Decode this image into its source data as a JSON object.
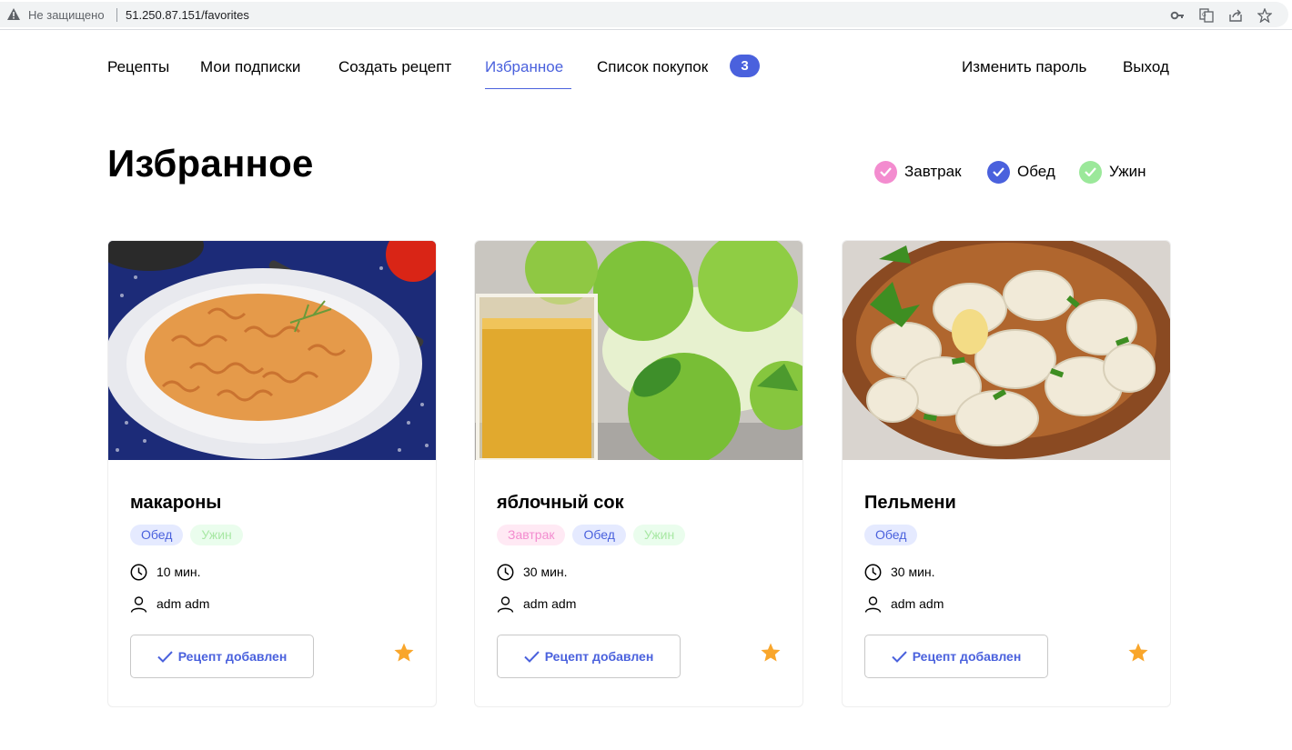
{
  "browser": {
    "security_text": "Не защищено",
    "url": "51.250.87.151/favorites",
    "icons": [
      "warning-icon",
      "key-icon",
      "translate-icon",
      "share-icon",
      "bookmark-star-icon"
    ]
  },
  "nav": {
    "recipes": "Рецепты",
    "subscriptions": "Мои подписки",
    "create_recipe": "Создать рецепт",
    "favorites": "Избранное",
    "shopping_list": "Список покупок",
    "cart_count": "3",
    "change_password": "Изменить пароль",
    "logout": "Выход"
  },
  "page": {
    "title": "Избранное"
  },
  "filters": [
    {
      "label": "Завтрак",
      "color": "#f38ccf",
      "checked": true
    },
    {
      "label": "Обед",
      "color": "#4a61dd",
      "checked": true
    },
    {
      "label": "Ужин",
      "color": "#9be89a",
      "checked": true
    }
  ],
  "colors": {
    "accent": "#4a61dd",
    "star": "#f9a62b"
  },
  "cards": [
    {
      "title": "макароны",
      "tags": [
        "Обед",
        "Ужин"
      ],
      "time": "10 мин.",
      "author": "adm adm",
      "button_label": "Рецепт добавлен",
      "favorited": true
    },
    {
      "title": "яблочный сок",
      "tags": [
        "Завтрак",
        "Обед",
        "Ужин"
      ],
      "time": "30 мин.",
      "author": "adm adm",
      "button_label": "Рецепт добавлен",
      "favorited": true
    },
    {
      "title": "Пельмени",
      "tags": [
        "Обед"
      ],
      "time": "30 мин.",
      "author": "adm adm",
      "button_label": "Рецепт добавлен",
      "favorited": true
    }
  ]
}
